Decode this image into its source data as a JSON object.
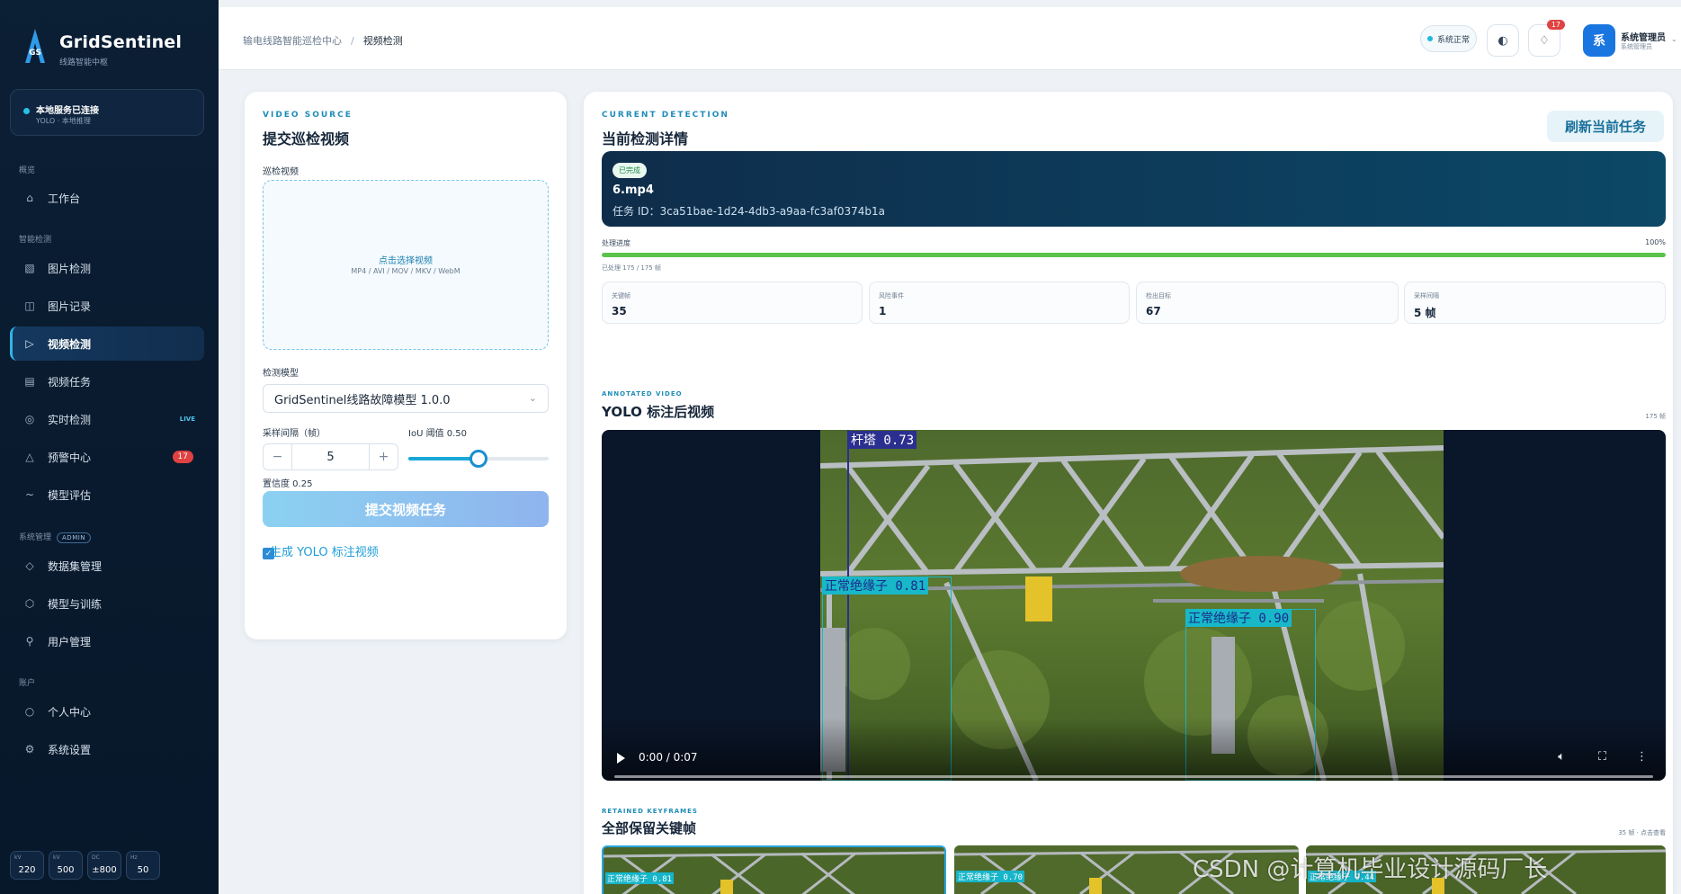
{
  "brand": {
    "title": "GridSentinel",
    "subtitle": "线路智能中枢",
    "logo_text": "GS"
  },
  "service": {
    "title": "本地服务已连接",
    "subtitle": "YOLO · 本地推理"
  },
  "nav": {
    "groups": [
      "概览",
      "智能检测",
      "系统管理",
      "账户"
    ],
    "admin_tag": "ADMIN",
    "items": [
      {
        "label": "工作台",
        "icon": "home-icon",
        "glyph": "⌂"
      },
      {
        "label": "图片检测",
        "icon": "image-icon",
        "glyph": "▧"
      },
      {
        "label": "图片记录",
        "icon": "record-icon",
        "glyph": "◫"
      },
      {
        "label": "视频检测",
        "icon": "play-icon",
        "glyph": "▷",
        "active": true
      },
      {
        "label": "视频任务",
        "icon": "list-icon",
        "glyph": "▤"
      },
      {
        "label": "实时检测",
        "icon": "target-icon",
        "glyph": "◎",
        "tag": "LIVE"
      },
      {
        "label": "预警中心",
        "icon": "alert-icon",
        "glyph": "△",
        "badge": "17"
      },
      {
        "label": "模型评估",
        "icon": "chart-icon",
        "glyph": "~"
      },
      {
        "label": "数据集管理",
        "icon": "dataset-icon",
        "glyph": "◇"
      },
      {
        "label": "模型与训练",
        "icon": "model-icon",
        "glyph": "⬡"
      },
      {
        "label": "用户管理",
        "icon": "user-icon",
        "glyph": "⚲"
      },
      {
        "label": "个人中心",
        "icon": "profile-icon",
        "glyph": "○"
      },
      {
        "label": "系统设置",
        "icon": "settings-icon",
        "glyph": "⚙"
      }
    ]
  },
  "stats": [
    {
      "label": "kV",
      "value": "220"
    },
    {
      "label": "kV",
      "value": "500"
    },
    {
      "label": "DC",
      "value": "±800"
    },
    {
      "label": "Hz",
      "value": "50"
    }
  ],
  "topbar": {
    "breadcrumb": [
      "输电线路智能巡检中心",
      "视频检测"
    ],
    "status": "系统正常",
    "theme_icon": "◐",
    "bell_icon": "♢",
    "bell_badge": "17",
    "avatar": "系",
    "user_name": "系统管理员",
    "user_role": "系统管理员"
  },
  "upload": {
    "eyebrow": "VIDEO SOURCE",
    "title": "提交巡检视频",
    "video_label": "巡检视频",
    "dropzone_title": "点击选择视频",
    "dropzone_formats": "MP4 / AVI / MOV / MKV / WebM",
    "model_label": "检测模型",
    "model_value": "GridSentinel线路故障模型 1.0.0",
    "interval_label": "采样间隔（帧）",
    "interval_value": "5",
    "iou_label": "IoU 阈值 0.50",
    "iou_value": 0.5,
    "conf_label": "置信度 0.25",
    "conf_value": 0.25,
    "checkbox_label": "生成 YOLO 标注视频",
    "checkbox_checked": true,
    "submit_label": "提交视频任务"
  },
  "detail": {
    "eyebrow": "CURRENT DETECTION",
    "title": "当前检测详情",
    "refresh_label": "刷新当前任务",
    "status_tag": "已完成",
    "file_name": "6.mp4",
    "task_id": "任务 ID：3ca51bae-1d24-4db3-a9aa-fc3af0374b1a",
    "progress_label": "处理进度",
    "progress_pct": "100%",
    "progress_value": 1.0,
    "progress_sub": "已处理 175 / 175 帧",
    "metrics": [
      {
        "label": "关键帧",
        "value": "35"
      },
      {
        "label": "风险事件",
        "value": "1"
      },
      {
        "label": "检出目标",
        "value": "67"
      },
      {
        "label": "采样间隔",
        "value": "5 帧"
      }
    ],
    "video_eyebrow": "ANNOTATED VIDEO",
    "video_title": "YOLO 标注后视频",
    "video_meta": "175 帧",
    "video_time": "0:00 / 0:07",
    "detections": [
      {
        "label": "杆塔  0.73",
        "color": "#2b2f8f",
        "text": "#ffffff"
      },
      {
        "label": "正常绝缘子  0.81",
        "color": "#18b8c8",
        "text": "#1a2a8a"
      },
      {
        "label": "正常绝缘子  0.90",
        "color": "#18b8c8",
        "text": "#1a2a8a"
      }
    ],
    "keyframes_eyebrow": "RETAINED KEYFRAMES",
    "keyframes_title": "全部保留关键帧",
    "keyframes_meta": "35 帧 · 点击查看",
    "keyframes": [
      {
        "label": "正常绝缘子  0.81"
      },
      {
        "label": "正常绝缘子  0.70"
      },
      {
        "label": "正常绝缘子  0.44"
      }
    ]
  },
  "watermark": "CSDN @计算机毕业设计源码厂长"
}
